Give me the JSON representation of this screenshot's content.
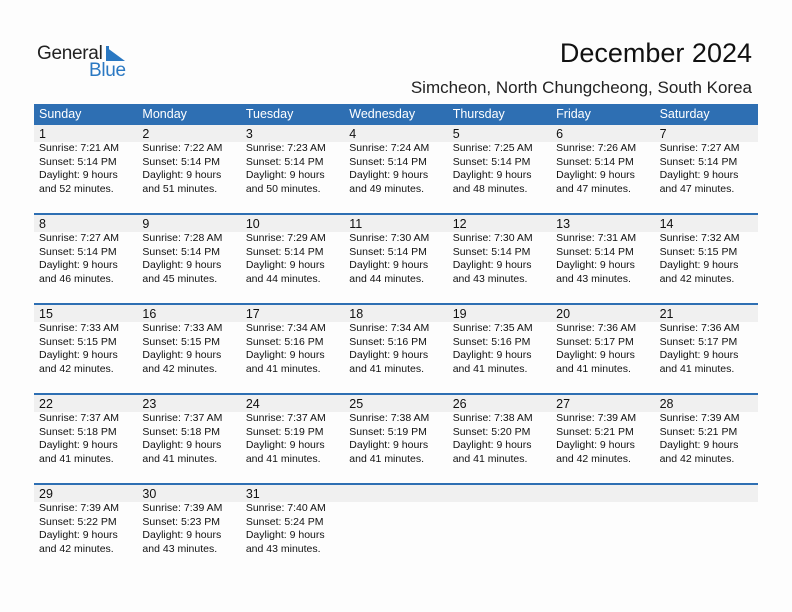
{
  "logo": {
    "text_general": "General",
    "text_blue": "Blue",
    "accent_color": "#2a78c2"
  },
  "header": {
    "title": "December 2024",
    "location": "Simcheon, North Chungcheong, South Korea"
  },
  "colors": {
    "header_bg": "#2e6fb3",
    "day_row_bg": "#f0f0f0"
  },
  "weekdays": [
    "Sunday",
    "Monday",
    "Tuesday",
    "Wednesday",
    "Thursday",
    "Friday",
    "Saturday"
  ],
  "weeks": [
    [
      {
        "day": "1",
        "sunrise": "Sunrise: 7:21 AM",
        "sunset": "Sunset: 5:14 PM",
        "daylight": "Daylight: 9 hours",
        "minutes": "and 52 minutes."
      },
      {
        "day": "2",
        "sunrise": "Sunrise: 7:22 AM",
        "sunset": "Sunset: 5:14 PM",
        "daylight": "Daylight: 9 hours",
        "minutes": "and 51 minutes."
      },
      {
        "day": "3",
        "sunrise": "Sunrise: 7:23 AM",
        "sunset": "Sunset: 5:14 PM",
        "daylight": "Daylight: 9 hours",
        "minutes": "and 50 minutes."
      },
      {
        "day": "4",
        "sunrise": "Sunrise: 7:24 AM",
        "sunset": "Sunset: 5:14 PM",
        "daylight": "Daylight: 9 hours",
        "minutes": "and 49 minutes."
      },
      {
        "day": "5",
        "sunrise": "Sunrise: 7:25 AM",
        "sunset": "Sunset: 5:14 PM",
        "daylight": "Daylight: 9 hours",
        "minutes": "and 48 minutes."
      },
      {
        "day": "6",
        "sunrise": "Sunrise: 7:26 AM",
        "sunset": "Sunset: 5:14 PM",
        "daylight": "Daylight: 9 hours",
        "minutes": "and 47 minutes."
      },
      {
        "day": "7",
        "sunrise": "Sunrise: 7:27 AM",
        "sunset": "Sunset: 5:14 PM",
        "daylight": "Daylight: 9 hours",
        "minutes": "and 47 minutes."
      }
    ],
    [
      {
        "day": "8",
        "sunrise": "Sunrise: 7:27 AM",
        "sunset": "Sunset: 5:14 PM",
        "daylight": "Daylight: 9 hours",
        "minutes": "and 46 minutes."
      },
      {
        "day": "9",
        "sunrise": "Sunrise: 7:28 AM",
        "sunset": "Sunset: 5:14 PM",
        "daylight": "Daylight: 9 hours",
        "minutes": "and 45 minutes."
      },
      {
        "day": "10",
        "sunrise": "Sunrise: 7:29 AM",
        "sunset": "Sunset: 5:14 PM",
        "daylight": "Daylight: 9 hours",
        "minutes": "and 44 minutes."
      },
      {
        "day": "11",
        "sunrise": "Sunrise: 7:30 AM",
        "sunset": "Sunset: 5:14 PM",
        "daylight": "Daylight: 9 hours",
        "minutes": "and 44 minutes."
      },
      {
        "day": "12",
        "sunrise": "Sunrise: 7:30 AM",
        "sunset": "Sunset: 5:14 PM",
        "daylight": "Daylight: 9 hours",
        "minutes": "and 43 minutes."
      },
      {
        "day": "13",
        "sunrise": "Sunrise: 7:31 AM",
        "sunset": "Sunset: 5:14 PM",
        "daylight": "Daylight: 9 hours",
        "minutes": "and 43 minutes."
      },
      {
        "day": "14",
        "sunrise": "Sunrise: 7:32 AM",
        "sunset": "Sunset: 5:15 PM",
        "daylight": "Daylight: 9 hours",
        "minutes": "and 42 minutes."
      }
    ],
    [
      {
        "day": "15",
        "sunrise": "Sunrise: 7:33 AM",
        "sunset": "Sunset: 5:15 PM",
        "daylight": "Daylight: 9 hours",
        "minutes": "and 42 minutes."
      },
      {
        "day": "16",
        "sunrise": "Sunrise: 7:33 AM",
        "sunset": "Sunset: 5:15 PM",
        "daylight": "Daylight: 9 hours",
        "minutes": "and 42 minutes."
      },
      {
        "day": "17",
        "sunrise": "Sunrise: 7:34 AM",
        "sunset": "Sunset: 5:16 PM",
        "daylight": "Daylight: 9 hours",
        "minutes": "and 41 minutes."
      },
      {
        "day": "18",
        "sunrise": "Sunrise: 7:34 AM",
        "sunset": "Sunset: 5:16 PM",
        "daylight": "Daylight: 9 hours",
        "minutes": "and 41 minutes."
      },
      {
        "day": "19",
        "sunrise": "Sunrise: 7:35 AM",
        "sunset": "Sunset: 5:16 PM",
        "daylight": "Daylight: 9 hours",
        "minutes": "and 41 minutes."
      },
      {
        "day": "20",
        "sunrise": "Sunrise: 7:36 AM",
        "sunset": "Sunset: 5:17 PM",
        "daylight": "Daylight: 9 hours",
        "minutes": "and 41 minutes."
      },
      {
        "day": "21",
        "sunrise": "Sunrise: 7:36 AM",
        "sunset": "Sunset: 5:17 PM",
        "daylight": "Daylight: 9 hours",
        "minutes": "and 41 minutes."
      }
    ],
    [
      {
        "day": "22",
        "sunrise": "Sunrise: 7:37 AM",
        "sunset": "Sunset: 5:18 PM",
        "daylight": "Daylight: 9 hours",
        "minutes": "and 41 minutes."
      },
      {
        "day": "23",
        "sunrise": "Sunrise: 7:37 AM",
        "sunset": "Sunset: 5:18 PM",
        "daylight": "Daylight: 9 hours",
        "minutes": "and 41 minutes."
      },
      {
        "day": "24",
        "sunrise": "Sunrise: 7:37 AM",
        "sunset": "Sunset: 5:19 PM",
        "daylight": "Daylight: 9 hours",
        "minutes": "and 41 minutes."
      },
      {
        "day": "25",
        "sunrise": "Sunrise: 7:38 AM",
        "sunset": "Sunset: 5:19 PM",
        "daylight": "Daylight: 9 hours",
        "minutes": "and 41 minutes."
      },
      {
        "day": "26",
        "sunrise": "Sunrise: 7:38 AM",
        "sunset": "Sunset: 5:20 PM",
        "daylight": "Daylight: 9 hours",
        "minutes": "and 41 minutes."
      },
      {
        "day": "27",
        "sunrise": "Sunrise: 7:39 AM",
        "sunset": "Sunset: 5:21 PM",
        "daylight": "Daylight: 9 hours",
        "minutes": "and 42 minutes."
      },
      {
        "day": "28",
        "sunrise": "Sunrise: 7:39 AM",
        "sunset": "Sunset: 5:21 PM",
        "daylight": "Daylight: 9 hours",
        "minutes": "and 42 minutes."
      }
    ],
    [
      {
        "day": "29",
        "sunrise": "Sunrise: 7:39 AM",
        "sunset": "Sunset: 5:22 PM",
        "daylight": "Daylight: 9 hours",
        "minutes": "and 42 minutes."
      },
      {
        "day": "30",
        "sunrise": "Sunrise: 7:39 AM",
        "sunset": "Sunset: 5:23 PM",
        "daylight": "Daylight: 9 hours",
        "minutes": "and 43 minutes."
      },
      {
        "day": "31",
        "sunrise": "Sunrise: 7:40 AM",
        "sunset": "Sunset: 5:24 PM",
        "daylight": "Daylight: 9 hours",
        "minutes": "and 43 minutes."
      },
      null,
      null,
      null,
      null
    ]
  ]
}
